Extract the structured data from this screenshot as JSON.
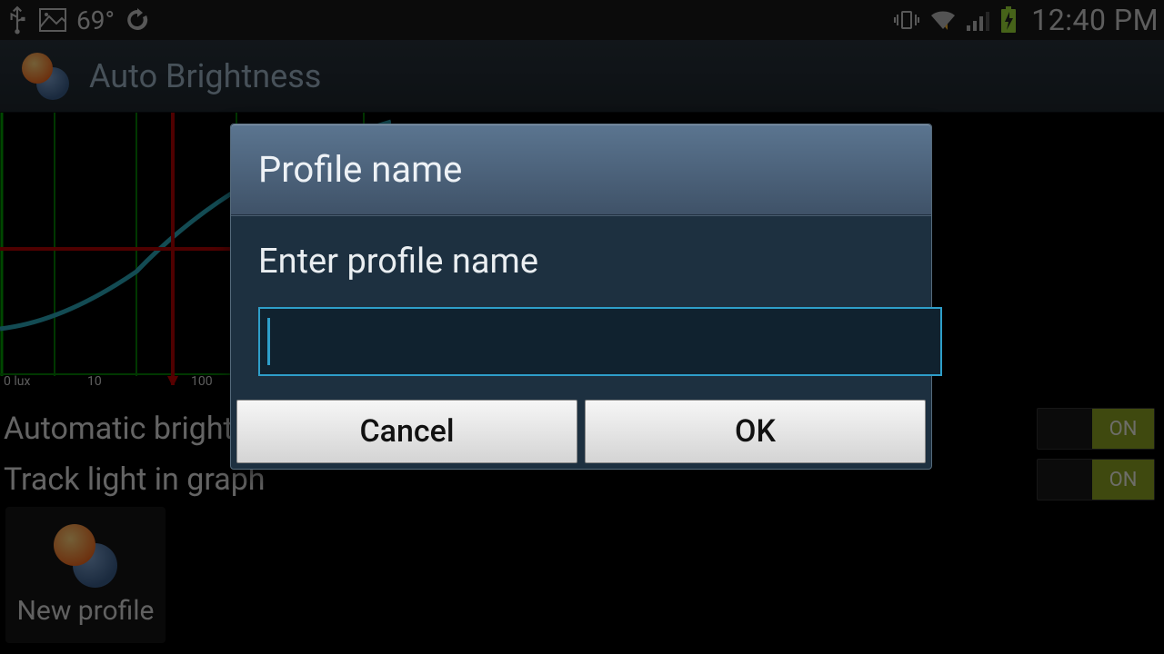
{
  "statusbar": {
    "temp": "69°",
    "clock": "12:40 PM"
  },
  "app": {
    "title": "Auto Brightness"
  },
  "graph": {
    "axis_labels": [
      "0 lux",
      "10",
      "100"
    ]
  },
  "settings": {
    "auto_brightness_label": "Automatic brightness",
    "track_light_label": "Track light in graph",
    "toggle_on_text": "ON"
  },
  "profile_tile": {
    "label": "New profile"
  },
  "dialog": {
    "title": "Profile name",
    "prompt": "Enter profile name",
    "input_value": "",
    "cancel_label": "Cancel",
    "ok_label": "OK"
  }
}
